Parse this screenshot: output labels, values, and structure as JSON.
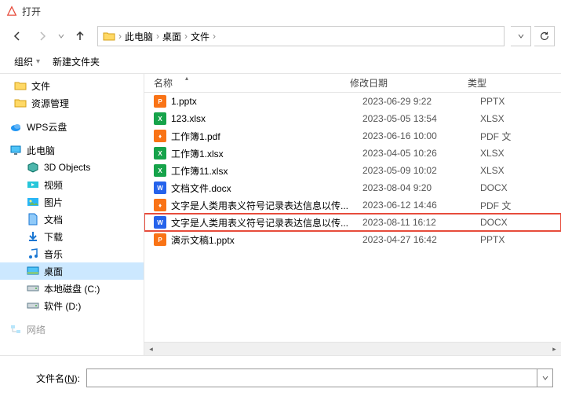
{
  "title": "打开",
  "nav": {
    "breadcrumb": [
      "此电脑",
      "桌面",
      "文件"
    ]
  },
  "toolbar": {
    "organize": "组织",
    "newfolder": "新建文件夹"
  },
  "columns": {
    "name": "名称",
    "date": "修改日期",
    "type": "类型"
  },
  "sidebar": {
    "items": [
      {
        "label": "文件",
        "icon": "folder",
        "indent": "top"
      },
      {
        "label": "资源管理",
        "icon": "folder",
        "indent": "top"
      },
      {
        "label": "",
        "spacer": true
      },
      {
        "label": "WPS云盘",
        "icon": "wpscloud",
        "indent": "section"
      },
      {
        "label": "",
        "spacer": true
      },
      {
        "label": "此电脑",
        "icon": "thispc",
        "indent": "section"
      },
      {
        "label": "3D Objects",
        "icon": "3d",
        "indent": "sub"
      },
      {
        "label": "视频",
        "icon": "video",
        "indent": "sub"
      },
      {
        "label": "图片",
        "icon": "picture",
        "indent": "sub"
      },
      {
        "label": "文档",
        "icon": "document",
        "indent": "sub"
      },
      {
        "label": "下载",
        "icon": "download",
        "indent": "sub"
      },
      {
        "label": "音乐",
        "icon": "music",
        "indent": "sub"
      },
      {
        "label": "桌面",
        "icon": "desktop",
        "indent": "sub",
        "selected": true
      },
      {
        "label": "本地磁盘 (C:)",
        "icon": "disk",
        "indent": "sub"
      },
      {
        "label": "软件 (D:)",
        "icon": "disk",
        "indent": "sub"
      },
      {
        "label": "",
        "spacer": true
      },
      {
        "label": "网络",
        "icon": "network",
        "indent": "section",
        "cut": true
      }
    ]
  },
  "files": [
    {
      "name": "1.pptx",
      "date": "2023-06-29 9:22",
      "type": "PPTX",
      "icon": "ppt"
    },
    {
      "name": "123.xlsx",
      "date": "2023-05-05 13:54",
      "type": "XLSX",
      "icon": "xls"
    },
    {
      "name": "工作簿1.pdf",
      "date": "2023-06-16 10:00",
      "type": "PDF 文",
      "icon": "pdf"
    },
    {
      "name": "工作簿1.xlsx",
      "date": "2023-04-05 10:26",
      "type": "XLSX",
      "icon": "xls"
    },
    {
      "name": "工作簿11.xlsx",
      "date": "2023-05-09 10:02",
      "type": "XLSX",
      "icon": "xls"
    },
    {
      "name": "文档文件.docx",
      "date": "2023-08-04 9:20",
      "type": "DOCX",
      "icon": "doc"
    },
    {
      "name": "文字是人类用表义符号记录表达信息以传...",
      "date": "2023-06-12 14:46",
      "type": "PDF 文",
      "icon": "pdf"
    },
    {
      "name": "文字是人类用表义符号记录表达信息以传...",
      "date": "2023-08-11 16:12",
      "type": "DOCX",
      "icon": "doc",
      "highlighted": true
    },
    {
      "name": "演示文稿1.pptx",
      "date": "2023-04-27 16:42",
      "type": "PPTX",
      "icon": "ppt"
    }
  ],
  "bottom": {
    "filename_label_pre": "文件名(",
    "filename_label_u": "N",
    "filename_label_post": "):",
    "filename_value": ""
  }
}
